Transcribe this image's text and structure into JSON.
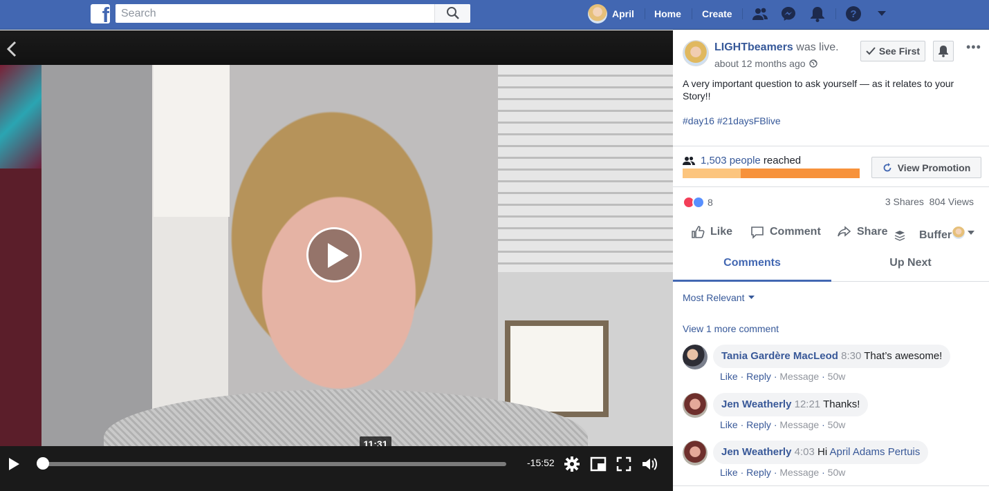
{
  "topbar": {
    "logo": "f",
    "search_placeholder": "Search",
    "user_name": "April",
    "home": "Home",
    "create": "Create",
    "icons": [
      "friends-icon",
      "messenger-icon",
      "notifications-icon",
      "help-icon",
      "dropdown-icon"
    ]
  },
  "video": {
    "hover_time": "11:31",
    "time_remaining": "-15:52",
    "progress_fraction": 0.01,
    "controls": [
      "play-icon",
      "settings-icon",
      "pip-icon",
      "fullscreen-icon",
      "volume-icon"
    ]
  },
  "post": {
    "page_name": "LIGHTbeamers",
    "was_live": "was live.",
    "time": "about 12 months ago",
    "see_first": "See First",
    "body": "A very important question to ask yourself — as it relates to your Story!!",
    "hashtags": "#day16 #21daysFBlive",
    "reach_count": "1,503 people",
    "reach_label": "reached",
    "reach_fraction": 0.33,
    "view_promotion": "View Promotion",
    "reaction_count": "8",
    "shares": "3 Shares",
    "views": "804 Views"
  },
  "actions": {
    "like": "Like",
    "comment": "Comment",
    "share": "Share",
    "buffer": "Buffer"
  },
  "tabs": {
    "comments": "Comments",
    "up_next": "Up Next"
  },
  "comments_section": {
    "sort": "Most Relevant",
    "view_more": "View 1 more comment",
    "action_like": "Like",
    "action_reply": "Reply",
    "action_message": "Message",
    "items": [
      {
        "author": "Tania Gardère MacLeod",
        "timestamp": "8:30",
        "text": "That’s awesome!",
        "mention": "",
        "age": "50w"
      },
      {
        "author": "Jen Weatherly",
        "timestamp": "12:21",
        "text": "Thanks!",
        "mention": "",
        "age": "50w"
      },
      {
        "author": "Jen Weatherly",
        "timestamp": "4:03",
        "text": "Hi",
        "mention": "April Adams Pertuis",
        "age": "50w"
      }
    ]
  },
  "colors": {
    "brand": "#4267b2",
    "link": "#365899",
    "reach_bar": "#f7923b",
    "reach_bar_light": "#fcc57e"
  }
}
